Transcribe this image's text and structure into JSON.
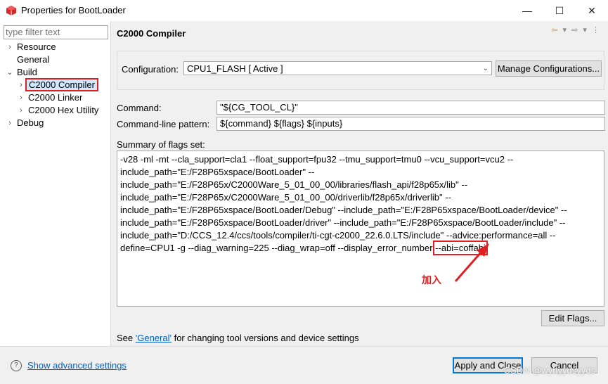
{
  "window": {
    "title": "Properties for BootLoader",
    "minimize": "—",
    "maximize": "☐",
    "close": "✕"
  },
  "left": {
    "filter_placeholder": "type filter text",
    "tree": [
      {
        "label": "Resource",
        "expand": ">"
      },
      {
        "label": "General",
        "expand": ""
      },
      {
        "label": "Build",
        "expand": "v"
      },
      {
        "label": "C2000 Compiler",
        "expand": ">",
        "selected": true
      },
      {
        "label": "C2000 Linker",
        "expand": ">"
      },
      {
        "label": "C2000 Hex Utility",
        "expand": ">"
      },
      {
        "label": "Debug",
        "expand": ">"
      }
    ]
  },
  "main": {
    "title": "C2000 Compiler",
    "configuration_label": "Configuration:",
    "configuration_value": "CPU1_FLASH  [ Active ]",
    "manage_button": "Manage Configurations...",
    "command_label": "Command:",
    "command_value": "\"${CG_TOOL_CL}\"",
    "pattern_label": "Command-line pattern:",
    "pattern_value": "${command} ${flags} ${inputs}",
    "summary_label": "Summary of flags set:",
    "summary_lines": [
      "-v28 -ml -mt --cla_support=cla1 --float_support=fpu32 --tmu_support=tmu0 --vcu_support=vcu2 --",
      "include_path=\"E:/F28P65xspace/BootLoader\" --",
      "include_path=\"E:/F28P65x/C2000Ware_5_01_00_00/libraries/flash_api/f28p65x/lib\" --",
      "include_path=\"E:/F28P65x/C2000Ware_5_01_00_00/driverlib/f28p65x/driverlib\" --",
      "include_path=\"E:/F28P65xspace/BootLoader/Debug\" --include_path=\"E:/F28P65xspace/BootLoader/device\" --",
      "include_path=\"E:/F28P65xspace/BootLoader/driver\" --include_path=\"E:/F28P65xspace/BootLoader/include\" --",
      "include_path=\"D:/CCS_12.4/ccs/tools/compiler/ti-cgt-c2000_22.6.0.LTS/include\" --advice:performance=all --"
    ],
    "summary_last_prefix": "define=CPU1 -g --diag_warning=225 --diag_wrap=off --display_error_number ",
    "summary_last_highlight": "--abi=coffabi",
    "annotation": "加入",
    "edit_flags_button": "Edit Flags...",
    "footer_prefix": "See ",
    "footer_link": "'General'",
    "footer_suffix": " for changing tool versions and device settings"
  },
  "bottom": {
    "help_icon": "?",
    "advanced_link": "Show advanced settings",
    "apply_close_button": "Apply and Close",
    "cancel_button": "Cancel",
    "watermark": "CSDN @wyhyydsyyds"
  }
}
